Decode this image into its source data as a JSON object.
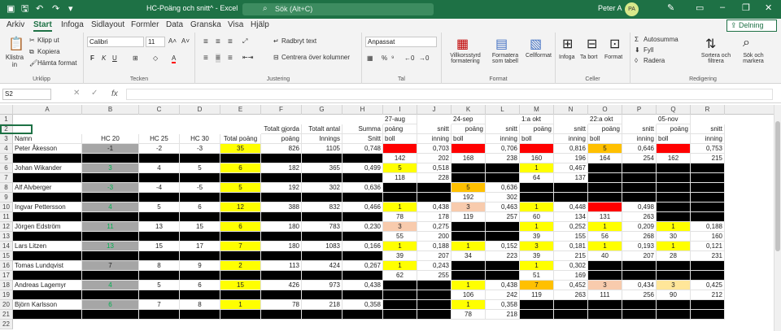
{
  "titlebar": {
    "title": "HC-Poäng och snitt^  -  Excel",
    "search_placeholder": "Sök (Alt+C)",
    "user": "Peter A",
    "initials": "PA"
  },
  "menus": [
    "Arkiv",
    "Start",
    "Infoga",
    "Sidlayout",
    "Formler",
    "Data",
    "Granska",
    "Visa",
    "Hjälp"
  ],
  "share": "Delning",
  "ribbon": {
    "urklipp": {
      "label": "Urklipp",
      "paste": "Klistra in",
      "cut": "Klipp ut",
      "copy": "Kopiera",
      "format_painter": "Hämta format"
    },
    "font": {
      "label": "Tecken",
      "name": "Calibri",
      "size": "11"
    },
    "alignment": {
      "label": "Justering",
      "wrap": "Radbryt text",
      "merge": "Centrera över kolumner"
    },
    "number": {
      "label": "Tal",
      "format": "Anpassat"
    },
    "styles": {
      "label": "Format",
      "cond": "Villkorsstyrd formatering",
      "table": "Formatera som tabell",
      "cell": "Cellformat"
    },
    "cells": {
      "label": "Celler",
      "insert": "Infoga",
      "delete": "Ta bort",
      "format": "Format"
    },
    "editing": {
      "label": "Redigering",
      "autosum": "Autosumma",
      "fill": "Fyll",
      "clear": "Radera",
      "sort": "Sortera och filtrera",
      "find": "Sök och markera"
    }
  },
  "formula": {
    "namebox": "S2",
    "fx": "fx"
  },
  "colors": {
    "yellow": "#ffff00",
    "orange": "#ffc000",
    "red": "#ff0000",
    "salmon": "#f8cbad",
    "lightyellow": "#ffe699",
    "gray": "#a6a6a6",
    "black": "#000000",
    "green": "#00b050"
  },
  "columns": [
    "A",
    "B",
    "C",
    "D",
    "E",
    "F",
    "G",
    "H",
    "I",
    "J",
    "K",
    "L",
    "M",
    "N",
    "O",
    "P",
    "Q",
    "R"
  ],
  "rows": {
    "r1": {
      "I": "27-aug",
      "K": "24-sep",
      "M": "1:a okt",
      "O": "22:a okt",
      "Q": "05-nov"
    },
    "r2": {
      "F": "Totalt gjorda",
      "G": "Totalt antal",
      "H": "Summa",
      "I": "poäng",
      "J": "snitt",
      "K": "poäng",
      "L": "snitt",
      "M": "poäng",
      "N": "snitt",
      "O": "poäng",
      "P": "snitt",
      "Q": "poäng",
      "R": "snitt"
    },
    "r3": {
      "A": "Namn",
      "B": "HC 20",
      "C": "HC 25",
      "D": "HC 30",
      "E": "Total poäng",
      "F": "poäng",
      "G": "Innings",
      "H": "Snitt",
      "I": "boll",
      "J": "inning",
      "K": "boll",
      "L": "inning",
      "M": "boll",
      "N": "inning",
      "O": "boll",
      "P": "inning",
      "Q": "boll",
      "R": "inning"
    },
    "r4": {
      "A": "Peter Åkesson",
      "B": "-1",
      "C": "-2",
      "D": "-3",
      "E": "35",
      "F": "826",
      "G": "1105",
      "H": "0,748",
      "I": "7",
      "J": "0,703",
      "K": "7",
      "L": "0,706",
      "M": "9",
      "N": "0,816",
      "O": "5",
      "P": "0,646",
      "Q": "7",
      "R": "0,753"
    },
    "r5": {
      "I": "142",
      "J": "202",
      "K": "168",
      "L": "238",
      "M": "160",
      "N": "196",
      "O": "164",
      "P": "254",
      "Q": "162",
      "R": "215"
    },
    "r6": {
      "A": "Johan Wikander",
      "B": "3",
      "C": "4",
      "D": "5",
      "E": "6",
      "F": "182",
      "G": "365",
      "H": "0,499",
      "I": "5",
      "J": "0,518",
      "M": "1",
      "N": "0,467"
    },
    "r7": {
      "I": "118",
      "J": "228",
      "M": "64",
      "N": "137"
    },
    "r8": {
      "A": "Alf Alvberger",
      "B": "-3",
      "C": "-4",
      "D": "-5",
      "E": "5",
      "F": "192",
      "G": "302",
      "H": "0,636",
      "K": "5",
      "L": "0,636"
    },
    "r9": {
      "K": "192",
      "L": "302"
    },
    "r10": {
      "A": "Ingvar Pettersson",
      "B": "4",
      "C": "5",
      "D": "6",
      "E": "12",
      "F": "388",
      "G": "832",
      "H": "0,466",
      "I": "1",
      "J": "0,438",
      "K": "3",
      "L": "0,463",
      "M": "1",
      "N": "0,448",
      "O": "7",
      "P": "0,498"
    },
    "r11": {
      "I": "78",
      "J": "178",
      "K": "119",
      "L": "257",
      "M": "60",
      "N": "134",
      "O": "131",
      "P": "263"
    },
    "r12": {
      "A": "Jörgen Edström",
      "B": "11",
      "C": "13",
      "D": "15",
      "E": "6",
      "F": "180",
      "G": "783",
      "H": "0,230",
      "I": "3",
      "J": "0,275",
      "M": "1",
      "N": "0,252",
      "O": "1",
      "P": "0,209",
      "Q": "1",
      "R": "0,188"
    },
    "r13": {
      "I": "55",
      "J": "200",
      "M": "39",
      "N": "155",
      "O": "56",
      "P": "268",
      "Q": "30",
      "R": "160"
    },
    "r14": {
      "A": "Lars Litzen",
      "B": "13",
      "C": "15",
      "D": "17",
      "E": "7",
      "F": "180",
      "G": "1083",
      "H": "0,166",
      "I": "1",
      "J": "0,188",
      "K": "1",
      "L": "0,152",
      "M": "3",
      "N": "0,181",
      "O": "1",
      "P": "0,193",
      "Q": "1",
      "R": "0,121"
    },
    "r15": {
      "I": "39",
      "J": "207",
      "K": "34",
      "L": "223",
      "M": "39",
      "N": "215",
      "O": "40",
      "P": "207",
      "Q": "28",
      "R": "231"
    },
    "r16": {
      "A": "Tomas Lundqvist",
      "B": "7",
      "C": "8",
      "D": "9",
      "E": "2",
      "F": "113",
      "G": "424",
      "H": "0,267",
      "I": "1",
      "J": "0,243",
      "M": "1",
      "N": "0,302"
    },
    "r17": {
      "I": "62",
      "J": "255",
      "M": "51",
      "N": "169"
    },
    "r18": {
      "A": "Andreas Lagemyr",
      "B": "4",
      "C": "5",
      "D": "6",
      "E": "15",
      "F": "426",
      "G": "973",
      "H": "0,438",
      "K": "1",
      "L": "0,438",
      "M": "7",
      "N": "0,452",
      "O": "3",
      "P": "0,434",
      "Q": "3",
      "R": "0,425"
    },
    "r19": {
      "K": "106",
      "L": "242",
      "M": "119",
      "N": "263",
      "O": "111",
      "P": "256",
      "Q": "90",
      "R": "212"
    },
    "r20": {
      "A": "Björn Karlsson",
      "B": "6",
      "C": "7",
      "D": "8",
      "E": "1",
      "F": "78",
      "G": "218",
      "H": "0,358",
      "K": "1",
      "L": "0,358"
    },
    "r21": {
      "K": "78",
      "L": "218"
    }
  }
}
